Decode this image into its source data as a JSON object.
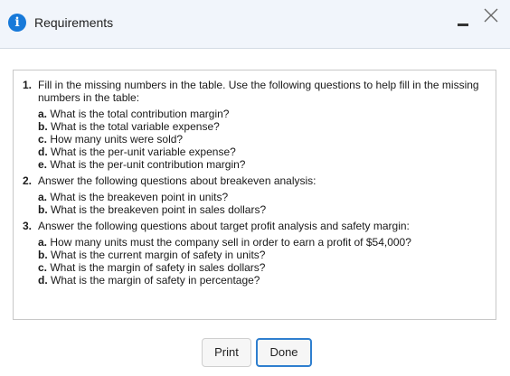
{
  "window": {
    "title": "Requirements",
    "info_glyph": "i",
    "icons": {
      "info": "info-icon",
      "minimize": "minimize-icon",
      "close": "close-icon"
    },
    "accent_color": "#1779d9"
  },
  "questions": [
    {
      "number": "1.",
      "text": "Fill in the missing numbers in the table. Use the following questions to help fill in the missing numbers in the table:",
      "subs": [
        {
          "letter": "a.",
          "text": "What is the total contribution margin?"
        },
        {
          "letter": "b.",
          "text": "What is the total variable expense?"
        },
        {
          "letter": "c.",
          "text": "How many units were sold?"
        },
        {
          "letter": "d.",
          "text": "What is the per-unit variable expense?"
        },
        {
          "letter": "e.",
          "text": "What is the per-unit contribution margin?"
        }
      ]
    },
    {
      "number": "2.",
      "text": "Answer the following questions about breakeven analysis:",
      "subs": [
        {
          "letter": "a.",
          "text": "What is the breakeven point in units?"
        },
        {
          "letter": "b.",
          "text": "What is the breakeven point in sales dollars?"
        }
      ]
    },
    {
      "number": "3.",
      "text": "Answer the following questions about target profit analysis and safety margin:",
      "subs": [
        {
          "letter": "a.",
          "text": "How many units must the company sell in order to earn a profit of $54,000?"
        },
        {
          "letter": "b.",
          "text": "What is the current margin of safety in units?"
        },
        {
          "letter": "c.",
          "text": "What is the margin of safety in sales dollars?"
        },
        {
          "letter": "d.",
          "text": "What is the margin of safety in percentage?"
        }
      ]
    }
  ],
  "buttons": {
    "print_label": "Print",
    "done_label": "Done"
  }
}
